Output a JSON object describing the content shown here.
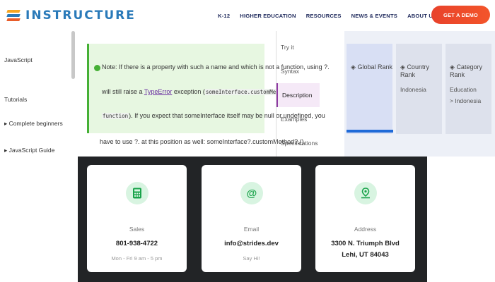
{
  "header": {
    "brand": "INSTRUCTURE",
    "nav": [
      "K-12",
      "HIGHER EDUCATION",
      "RESOURCES",
      "NEWS & EVENTS",
      "ABOUT US"
    ],
    "cta": "GET A DEMO"
  },
  "sidebar": {
    "items": [
      "JavaScript",
      "Tutorials",
      "Complete beginners",
      "JavaScript Guide"
    ]
  },
  "note": {
    "line1": "Note: If there is a property with such a name and which is not a function, using ?.",
    "line2_a": "will still raise a ",
    "line2_link": "TypeError",
    "line2_b": " exception (",
    "line2_code": "someInterface.customMethod is not a",
    "line3_code": "function",
    "line3_b": "). If you expect that someInterface itself may be null or undefined, you",
    "line4": "have to use ?. at this position as well: someInterface?.customMethod?.()"
  },
  "toc": {
    "items": [
      "Try it",
      "Syntax",
      "Description",
      "Examples",
      "Specifications"
    ],
    "active_index": 2
  },
  "ranks": [
    {
      "label": "Global Rank",
      "sub": []
    },
    {
      "label": "Country Rank",
      "sub": [
        "Indonesia"
      ]
    },
    {
      "label": "Category Rank",
      "sub": [
        "Education",
        "> Indonesia"
      ]
    }
  ],
  "contact": {
    "sales": {
      "title": "Sales",
      "value": "801-938-4722",
      "note": "Mon - Fri 9 am - 5 pm",
      "icon": "calculator-icon"
    },
    "email": {
      "title": "Email",
      "value": "info@strides.dev",
      "note": "Say Hi!",
      "icon": "at-sign-icon"
    },
    "address": {
      "title": "Address",
      "line1": "3300 N. Triumph Blvd",
      "line2": "Lehi, UT 84043",
      "icon": "map-pin-icon"
    }
  },
  "colors": {
    "brand": "#2a7ab9",
    "cta": "#f3552a",
    "note_bg": "#e7f7e1",
    "note_border": "#45b035",
    "toc_active": "#8e3aa3",
    "rank_bar": "#1f6ad8",
    "contact_bg": "#222426",
    "contact_icon": "#19a34a"
  }
}
